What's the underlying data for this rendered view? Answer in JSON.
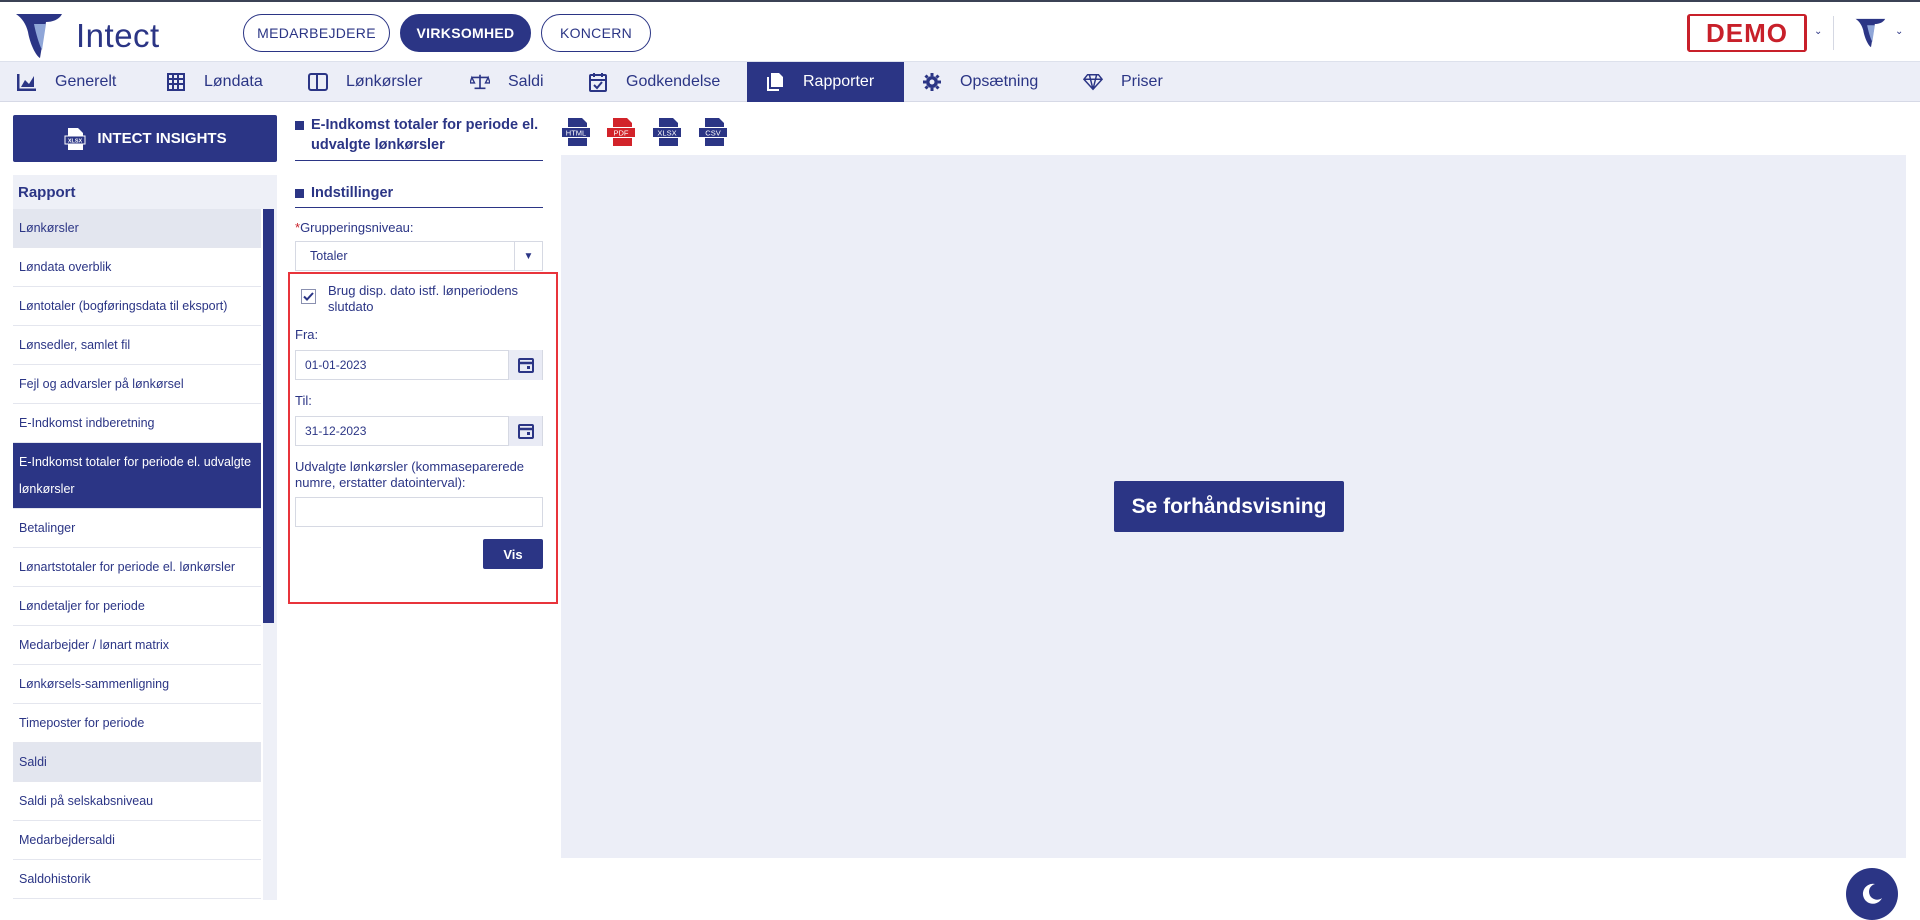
{
  "brand": {
    "name": "Intect",
    "accent": "#2b3585",
    "danger": "#c8202a"
  },
  "topbar": {
    "pills": [
      {
        "label": "MEDARBEJDERE",
        "active": false
      },
      {
        "label": "VIRKSOMHED",
        "active": true
      },
      {
        "label": "KONCERN",
        "active": false
      }
    ],
    "demo_label": "DEMO"
  },
  "nav": {
    "items": [
      {
        "label": "Generelt",
        "icon": "chart-icon"
      },
      {
        "label": "Løndata",
        "icon": "grid-icon"
      },
      {
        "label": "Lønkørsler",
        "icon": "columns-icon"
      },
      {
        "label": "Saldi",
        "icon": "scale-icon"
      },
      {
        "label": "Godkendelse",
        "icon": "calendar-check-icon"
      },
      {
        "label": "Rapporter",
        "icon": "documents-icon",
        "active": true
      },
      {
        "label": "Opsætning",
        "icon": "gear-icon"
      },
      {
        "label": "Priser",
        "icon": "diamond-icon"
      }
    ]
  },
  "sidebar": {
    "insights_label": "INTECT INSIGHTS",
    "insights_icon_text": "XLSX",
    "header": "Rapport",
    "items": [
      {
        "label": "Lønkørsler",
        "type": "group"
      },
      {
        "label": "Løndata overblik"
      },
      {
        "label": "Løntotaler (bogføringsdata til eksport)"
      },
      {
        "label": "Lønsedler, samlet fil"
      },
      {
        "label": "Fejl og advarsler på lønkørsel"
      },
      {
        "label": "E-Indkomst indberetning"
      },
      {
        "label": "E-Indkomst totaler for periode el. udvalgte lønkørsler",
        "selected": true
      },
      {
        "label": "Betalinger"
      },
      {
        "label": "Lønartstotaler for periode el. lønkørsler"
      },
      {
        "label": "Løndetaljer for periode"
      },
      {
        "label": "Medarbejder / lønart matrix"
      },
      {
        "label": "Lønkørsels-sammenligning"
      },
      {
        "label": "Timeposter for periode"
      },
      {
        "label": "Saldi",
        "type": "group"
      },
      {
        "label": "Saldi på selskabsniveau"
      },
      {
        "label": "Medarbejdersaldi"
      },
      {
        "label": "Saldohistorik"
      }
    ]
  },
  "report": {
    "title": "E-Indkomst totaler for periode el. udvalgte lønkørsler",
    "settings_title": "Indstillinger",
    "grouping_label": "Grupperingsniveau:",
    "grouping_required_mark": "*",
    "grouping_value": "Totaler",
    "use_disp_date_label": "Brug disp. dato istf. lønperiodens slutdato",
    "use_disp_date_checked": true,
    "from_label": "Fra:",
    "from_value": "01-01-2023",
    "to_label": "Til:",
    "to_value": "31-12-2023",
    "selected_runs_label": "Udvalgte lønkørsler (kommaseparerede numre, erstatter datointerval):",
    "selected_runs_value": "",
    "show_button": "Vis"
  },
  "export_formats": [
    {
      "label": "HTML",
      "color": "#2b3585"
    },
    {
      "label": "PDF",
      "color": "#d2232a"
    },
    {
      "label": "XLSX",
      "color": "#2b3585"
    },
    {
      "label": "CSV",
      "color": "#2b3585"
    }
  ],
  "preview": {
    "button_label": "Se forhåndsvisning"
  }
}
